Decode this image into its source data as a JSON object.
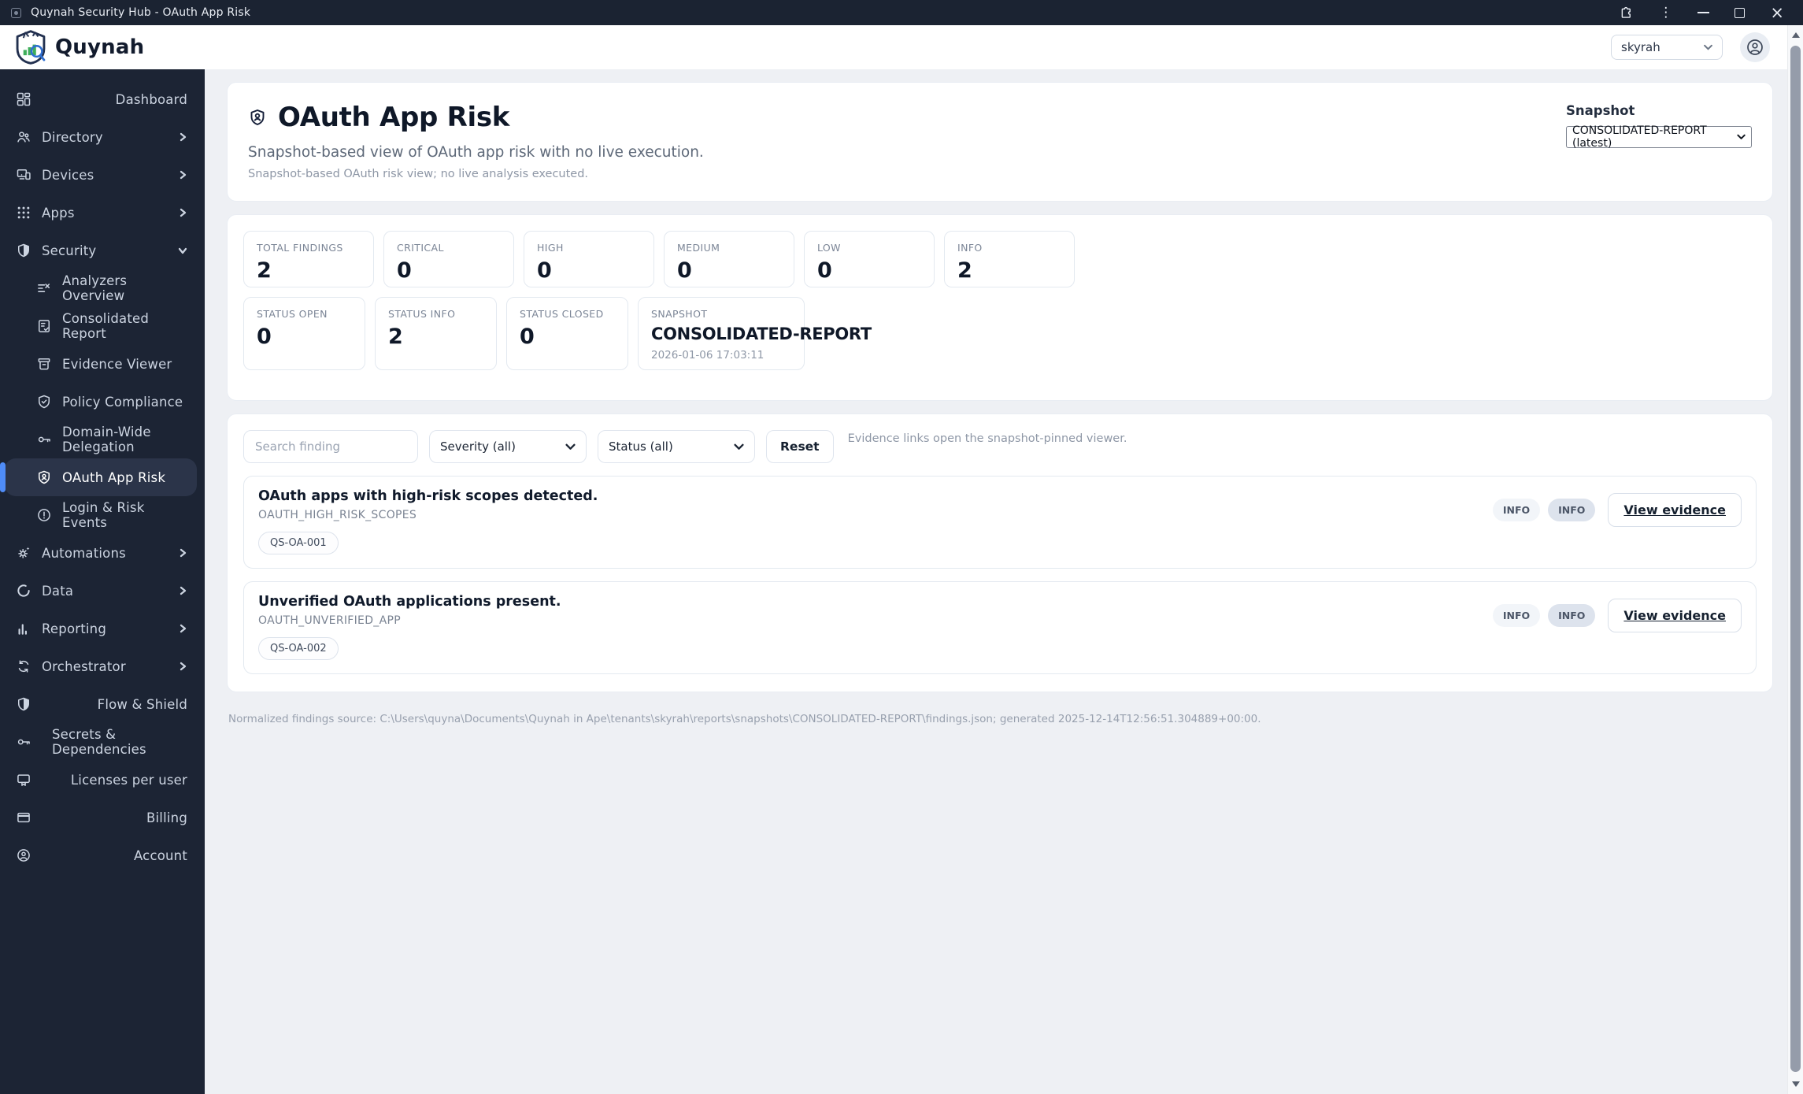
{
  "window": {
    "title": "Quynah Security Hub - OAuth App Risk"
  },
  "header": {
    "brand": "Quynah",
    "tenant_value": "skyrah"
  },
  "sidebar": {
    "items": [
      {
        "label": "Dashboard",
        "icon": "dashboard-grid-icon"
      },
      {
        "label": "Directory",
        "icon": "people-icon"
      },
      {
        "label": "Devices",
        "icon": "devices-icon"
      },
      {
        "label": "Apps",
        "icon": "apps-grid-icon"
      },
      {
        "label": "Security",
        "icon": "shield-icon"
      },
      {
        "label": "Analyzers Overview",
        "icon": "list-x-icon"
      },
      {
        "label": "Consolidated Report",
        "icon": "report-check-icon"
      },
      {
        "label": "Evidence Viewer",
        "icon": "archive-icon"
      },
      {
        "label": "Policy Compliance",
        "icon": "shield-check-icon"
      },
      {
        "label": "Domain-Wide Delegation",
        "icon": "key-icon"
      },
      {
        "label": "OAuth App Risk",
        "icon": "shield-person-icon",
        "selected": true
      },
      {
        "label": "Login & Risk Events",
        "icon": "alert-circle-icon"
      },
      {
        "label": "Automations",
        "icon": "gear-sparkle-icon"
      },
      {
        "label": "Data",
        "icon": "data-circle-icon"
      },
      {
        "label": "Reporting",
        "icon": "bar-chart-icon"
      },
      {
        "label": "Orchestrator",
        "icon": "sync-icon"
      },
      {
        "label": "Flow & Shield",
        "icon": "shield-icon"
      },
      {
        "label": "Secrets & Dependencies",
        "icon": "key-icon"
      },
      {
        "label": "Licenses per user",
        "icon": "license-icon"
      },
      {
        "label": "Billing",
        "icon": "credit-card-icon"
      },
      {
        "label": "Account",
        "icon": "person-circle-icon"
      }
    ]
  },
  "page": {
    "title": "OAuth App Risk",
    "subtitle": "Snapshot-based view of OAuth app risk with no live execution.",
    "note": "Snapshot-based OAuth risk view; no live analysis executed.",
    "snapshot_label": "Snapshot",
    "snapshot_value": "CONSOLIDATED-REPORT (latest)"
  },
  "stats": {
    "row1": [
      {
        "label": "TOTAL FINDINGS",
        "value": "2"
      },
      {
        "label": "CRITICAL",
        "value": "0"
      },
      {
        "label": "HIGH",
        "value": "0"
      },
      {
        "label": "MEDIUM",
        "value": "0"
      },
      {
        "label": "LOW",
        "value": "0"
      },
      {
        "label": "INFO",
        "value": "2"
      }
    ],
    "row2": [
      {
        "label": "STATUS OPEN",
        "value": "0"
      },
      {
        "label": "STATUS INFO",
        "value": "2"
      },
      {
        "label": "STATUS CLOSED",
        "value": "0"
      }
    ],
    "snapshot_card": {
      "label": "SNAPSHOT",
      "value": "CONSOLIDATED-REPORT",
      "timestamp": "2026-01-06 17:03:11"
    }
  },
  "filters": {
    "search_placeholder": "Search finding",
    "severity_value": "Severity (all)",
    "status_value": "Status (all)",
    "reset_label": "Reset",
    "note": "Evidence links open the snapshot-pinned viewer."
  },
  "findings": [
    {
      "title": "OAuth apps with high-risk scopes detected.",
      "rule_code": "OAUTH_HIGH_RISK_SCOPES",
      "finding_id": "QS-OA-001",
      "severity_badge": "INFO",
      "status_badge": "INFO",
      "action_label": "View evidence"
    },
    {
      "title": "Unverified OAuth applications present.",
      "rule_code": "OAUTH_UNVERIFIED_APP",
      "finding_id": "QS-OA-002",
      "severity_badge": "INFO",
      "status_badge": "INFO",
      "action_label": "View evidence"
    }
  ],
  "footer": {
    "text": "Normalized findings source: C:\\Users\\quyna\\Documents\\Quynah in Ape\\tenants\\skyrah\\reports\\snapshots\\CONSOLIDATED-REPORT\\findings.json; generated 2025-12-14T12:56:51.304889+00:00."
  },
  "colors": {
    "titlebar_bg": "#1b2332",
    "sidebar_bg": "#1c2434",
    "accent_blue": "#4f8cf7",
    "page_bg": "#eef0f4",
    "status_pill_bg": "#dde3ed",
    "logo_green": "#3fae5a",
    "logo_blue": "#2f6fd0"
  }
}
